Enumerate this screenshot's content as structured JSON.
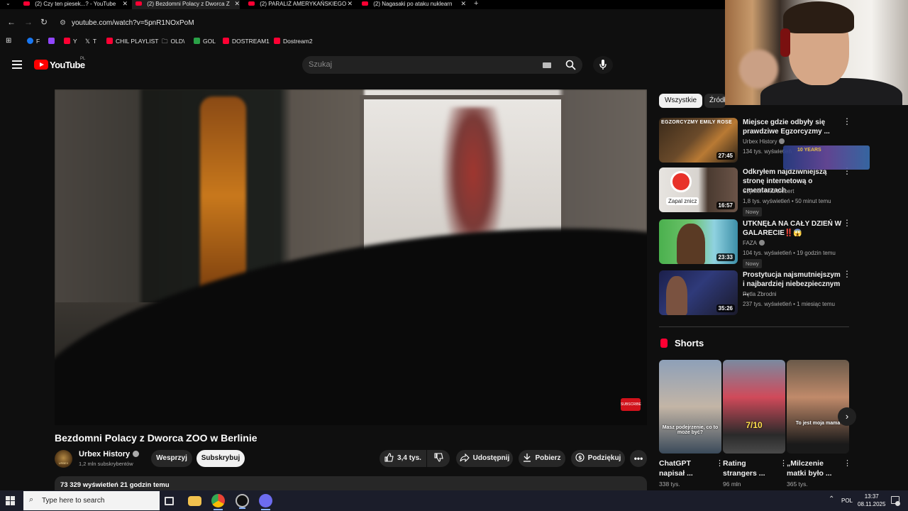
{
  "browser": {
    "tabs": [
      {
        "label": "(2) Czy ten piesek...? - YouTube",
        "active": false
      },
      {
        "label": "(2) Bezdomni Polacy z Dworca Z",
        "active": true
      },
      {
        "label": "(2) PARALIŻ AMERYKAŃSKIEGO",
        "active": false
      },
      {
        "label": "(2) Nagasaki po ataku nuklearn",
        "active": false
      }
    ],
    "new_tab": "+",
    "url": "youtube.com/watch?v=5pnR1NOxPoM",
    "bookmarks": [
      {
        "label": "F",
        "color": "#1877f2"
      },
      {
        "label": "Y",
        "color": "#ff0033"
      },
      {
        "label": "",
        "color": "#9146ff"
      },
      {
        "label": "T",
        "color": "#222222"
      },
      {
        "label": "CHIL PLAYLIST",
        "color": "#ff0033"
      },
      {
        "label": "OLD\\",
        "color": "#cccccc"
      },
      {
        "label": "GOL",
        "color": "#2aa147"
      },
      {
        "label": "DOSTREAM1",
        "color": "#ff0033"
      },
      {
        "label": "Dostream2",
        "color": "#ff0033"
      }
    ]
  },
  "header": {
    "logo_text": "YouTube",
    "country_code": "PL",
    "search_placeholder": "Szukaj"
  },
  "video": {
    "title": "Bezdomni Polacy z Dworca ZOO w Berlinie",
    "channel": "Urbex History",
    "avatar_text": "URBEX",
    "subscribers": "1,2 mln subskrybentów",
    "support_label": "Wesprzyj",
    "subscribe_label": "Subskrybuj",
    "likes": "3,4 tys.",
    "share_label": "Udostępnij",
    "download_label": "Pobierz",
    "thanks_label": "Podziękuj",
    "views_line": "73 329 wyświetleń  21 godzin temu",
    "watermark": "SUBSCRIBE"
  },
  "sidebar": {
    "chips": [
      "Wszystkie",
      "Źródło"
    ],
    "recommended": [
      {
        "title": "Miejsce gdzie odbyły się prawdziwe Egzorcyzmy ...",
        "channel": "Urbex History",
        "verified": true,
        "meta": "134 tys. wyświetleń",
        "duration": "27:45",
        "badge": "",
        "thumb_text": "EGZORCYZMY EMILY ROSE"
      },
      {
        "title": "Odkryłem najdziwniejszą stronę internetową o cmentarzach",
        "channel": "Szymon Hed Liebert",
        "verified": false,
        "meta": "1,8 tys. wyświetleń • 50 minut temu",
        "duration": "16:57",
        "badge": "Nowy",
        "thumb_text": "Zapal znicz"
      },
      {
        "title": "UTKNĘŁA NA CAŁY DZIEŃ W GALARECIE‼️😱",
        "channel": "FAZA",
        "verified": true,
        "meta": "104 tys. wyświetleń • 19 godzin temu",
        "duration": "23:33",
        "badge": "Nowy",
        "thumb_text": ""
      },
      {
        "title": "Prostytucja najsmutniejszym i najbardziej niebezpiecznym ...",
        "channel": "Pętla Zbrodni",
        "verified": false,
        "meta": "237 tys. wyświetleń • 1 miesiąc temu",
        "duration": "35:26",
        "badge": "",
        "thumb_text": ""
      }
    ],
    "shorts_heading": "Shorts",
    "shorts": [
      {
        "title": "ChatGPT napisał ...",
        "views": "338 tys.",
        "caption": "Masz podejrzenie, co to może być?"
      },
      {
        "title": "Rating strangers ...",
        "views": "96 mln",
        "caption": "7/10"
      },
      {
        "title": "„Milczenie matki było ...",
        "views": "365 tys.",
        "caption": "To jest moja mama"
      }
    ]
  },
  "overlay": {
    "sticker_text": "10 YEARS"
  },
  "taskbar": {
    "search_placeholder": "Type here to search",
    "language": "POL",
    "time": "13:37",
    "date": "08.11.2025"
  }
}
